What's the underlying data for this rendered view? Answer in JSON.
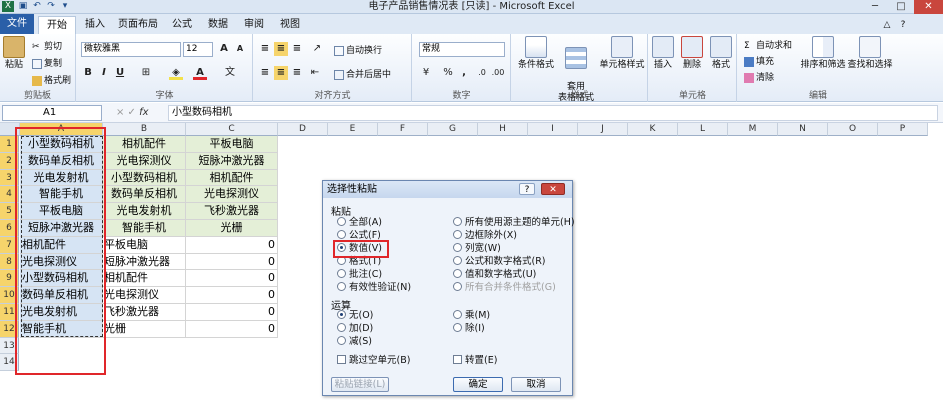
{
  "window": {
    "title": "电子产品销售情况表 [只读] - Microsoft Excel"
  },
  "quick_access": {
    "icons": [
      "excel-icon",
      "save-icon",
      "undo-icon",
      "redo-icon",
      "customize-icon"
    ]
  },
  "tabs": [
    {
      "label": "文件"
    },
    {
      "label": "开始"
    },
    {
      "label": "插入"
    },
    {
      "label": "页面布局"
    },
    {
      "label": "公式"
    },
    {
      "label": "数据"
    },
    {
      "label": "审阅"
    },
    {
      "label": "视图"
    }
  ],
  "ribbon": {
    "clipboard": {
      "paste": "粘贴",
      "cut": "剪切",
      "copy": "复制",
      "format_painter": "格式刷",
      "label": "剪贴板"
    },
    "font": {
      "name": "微软雅黑",
      "size": "12",
      "label": "字体",
      "bold": "B",
      "italic": "I",
      "underline": "U"
    },
    "alignment": {
      "wrap": "自动换行",
      "merge": "合并后居中",
      "label": "对齐方式"
    },
    "number": {
      "format": "常规",
      "label": "数字",
      "percent": "%",
      "comma": ","
    },
    "styles": {
      "conditional": "条件格式",
      "table": "套用\n表格格式",
      "cell_styles": "单元格样式",
      "label": "样式"
    },
    "cells": {
      "insert": "插入",
      "delete": "删除",
      "format": "格式",
      "label": "单元格"
    },
    "editing": {
      "autosum": "自动求和",
      "fill": "填充",
      "clear": "清除",
      "sort": "排序和筛选",
      "find": "查找和选择",
      "label": "编辑"
    }
  },
  "formula_bar": {
    "name_box": "A1",
    "fx": "fx",
    "value": "小型数码相机"
  },
  "sheet": {
    "columns": [
      "A",
      "B",
      "C",
      "D",
      "E",
      "F",
      "G",
      "H",
      "I",
      "J",
      "K",
      "L",
      "M",
      "N",
      "O",
      "P"
    ],
    "rows": [
      "1",
      "2",
      "3",
      "4",
      "5",
      "6",
      "7",
      "8",
      "9",
      "10",
      "11",
      "12",
      "13",
      "14"
    ],
    "col_a": [
      "小型数码相机",
      "数码单反相机",
      "光电发射机",
      "智能手机",
      "平板电脑",
      "短脉冲激光器",
      "相机配件",
      "光电探测仪",
      "小型数码相机",
      "数码单反相机",
      "光电发射机",
      "智能手机"
    ],
    "col_b": [
      "相机配件",
      "光电探测仪",
      "小型数码相机",
      "数码单反相机",
      "光电发射机",
      "智能手机",
      "平板电脑",
      "短脉冲激光器",
      "相机配件",
      "光电探测仪",
      "飞秒激光器",
      "光栅"
    ],
    "col_c": [
      "平板电脑",
      "短脉冲激光器",
      "相机配件",
      "光电探测仪",
      "飞秒激光器",
      "光栅",
      "0",
      "0",
      "0",
      "0",
      "0",
      "0"
    ]
  },
  "dialog": {
    "title": "选择性粘贴",
    "help": "?",
    "close": "✕",
    "paste_label": "粘贴",
    "paste_left": [
      "全部(A)",
      "公式(F)",
      "数值(V)",
      "格式(T)",
      "批注(C)",
      "有效性验证(N)"
    ],
    "paste_right": [
      "所有使用源主题的单元(H)",
      "边框除外(X)",
      "列宽(W)",
      "公式和数字格式(R)",
      "值和数字格式(U)",
      "所有合并条件格式(G)"
    ],
    "operation_label": "运算",
    "op_left": [
      "无(O)",
      "加(D)",
      "减(S)"
    ],
    "op_right": [
      "乘(M)",
      "除(I)"
    ],
    "skip_blanks": "跳过空单元(B)",
    "transpose": "转置(E)",
    "paste_link": "粘贴链接(L)",
    "ok": "确定",
    "cancel": "取消"
  },
  "colors": {
    "accent": "#2a5fa8",
    "highlight": "#e0262a",
    "group_a": "#d6e4f4",
    "group_b": "#e4efd7"
  }
}
